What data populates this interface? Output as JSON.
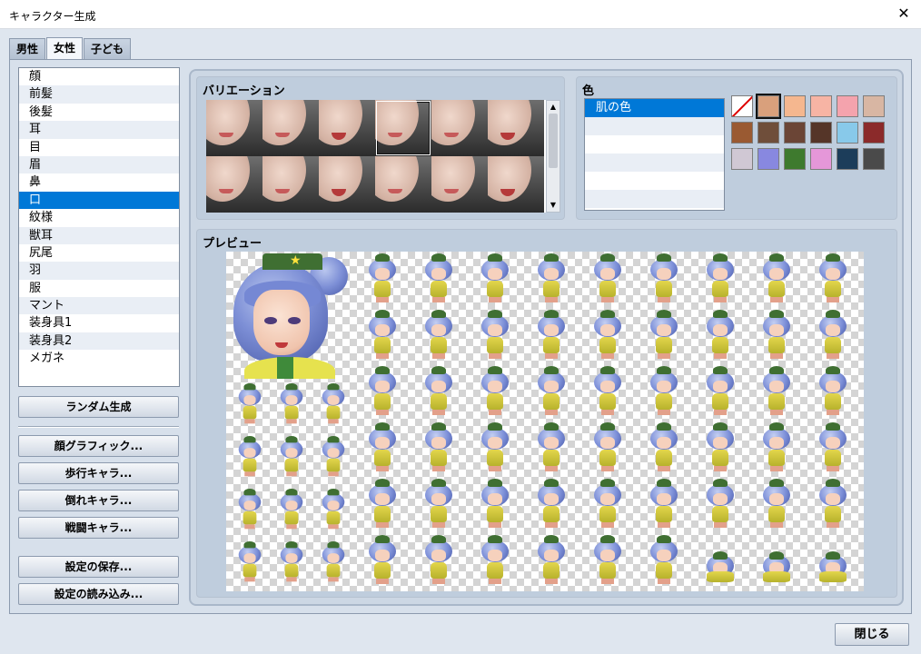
{
  "window": {
    "title": "キャラクター生成",
    "close_icon": "close-icon"
  },
  "tabs": [
    {
      "label": "男性",
      "active": false
    },
    {
      "label": "女性",
      "active": true
    },
    {
      "label": "子ども",
      "active": false
    }
  ],
  "parts": {
    "items": [
      "顔",
      "前髪",
      "後髪",
      "耳",
      "目",
      "眉",
      "鼻",
      "口",
      "紋様",
      "獣耳",
      "尻尾",
      "羽",
      "服",
      "マント",
      "装身具1",
      "装身具2",
      "メガネ"
    ],
    "selected": "口"
  },
  "buttons": {
    "random": "ランダム生成",
    "face_graphic": "顔グラフィック...",
    "walk_chara": "歩行キャラ...",
    "down_chara": "倒れキャラ...",
    "battle_chara": "戦闘キャラ...",
    "save_settings": "設定の保存...",
    "load_settings": "設定の読み込み...",
    "close": "閉じる"
  },
  "variation": {
    "title": "バリエーション",
    "selected_index": 3
  },
  "color": {
    "title": "色",
    "items": [
      "肌の色"
    ],
    "selected": "肌の色",
    "swatches": [
      "none",
      "#d9a07c",
      "#f5b78f",
      "#f7b4a4",
      "#f4a3ad",
      "#d8b6a3",
      "#9a5a32",
      "#6f4e3a",
      "#6b4536",
      "#553528",
      "#88c9ea",
      "#8b2a2a",
      "#d0c8d4",
      "#8888e0",
      "#3e7a2e",
      "#e597d9",
      "#1c3d5a",
      "#4a4a4a"
    ],
    "selected_swatch": 1
  },
  "preview": {
    "title": "プレビュー"
  }
}
